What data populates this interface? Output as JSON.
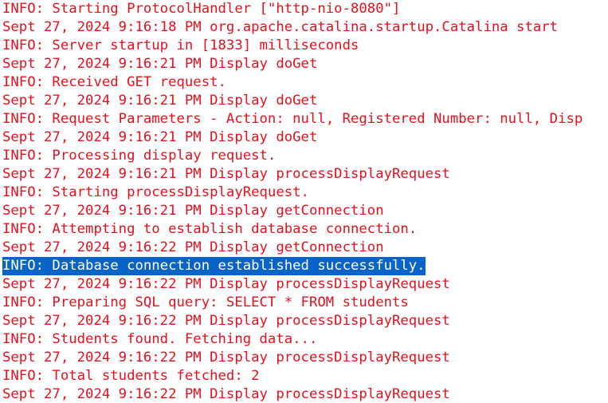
{
  "console": {
    "lines": [
      {
        "text": "INFO: Starting ProtocolHandler [\"http-nio-8080\"]",
        "selected": false
      },
      {
        "text": "Sept 27, 2024 9:16:18 PM org.apache.catalina.startup.Catalina start",
        "selected": false
      },
      {
        "text": "INFO: Server startup in [1833] milliseconds",
        "selected": false
      },
      {
        "text": "Sept 27, 2024 9:16:21 PM Display doGet",
        "selected": false
      },
      {
        "text": "INFO: Received GET request.",
        "selected": false
      },
      {
        "text": "Sept 27, 2024 9:16:21 PM Display doGet",
        "selected": false
      },
      {
        "text": "INFO: Request Parameters - Action: null, Registered Number: null, Disp",
        "selected": false
      },
      {
        "text": "Sept 27, 2024 9:16:21 PM Display doGet",
        "selected": false
      },
      {
        "text": "INFO: Processing display request.",
        "selected": false
      },
      {
        "text": "Sept 27, 2024 9:16:21 PM Display processDisplayRequest",
        "selected": false
      },
      {
        "text": "INFO: Starting processDisplayRequest.",
        "selected": false
      },
      {
        "text": "Sept 27, 2024 9:16:21 PM Display getConnection",
        "selected": false
      },
      {
        "text": "INFO: Attempting to establish database connection.",
        "selected": false
      },
      {
        "text": "Sept 27, 2024 9:16:22 PM Display getConnection",
        "selected": false
      },
      {
        "text": "INFO: Database connection established successfully.",
        "selected": true
      },
      {
        "text": "Sept 27, 2024 9:16:22 PM Display processDisplayRequest",
        "selected": false
      },
      {
        "text": "INFO: Preparing SQL query: SELECT * FROM students",
        "selected": false
      },
      {
        "text": "Sept 27, 2024 9:16:22 PM Display processDisplayRequest",
        "selected": false
      },
      {
        "text": "INFO: Students found. Fetching data...",
        "selected": false
      },
      {
        "text": "Sept 27, 2024 9:16:22 PM Display processDisplayRequest",
        "selected": false
      },
      {
        "text": "INFO: Total students fetched: 2",
        "selected": false
      },
      {
        "text": "Sept 27, 2024 9:16:22 PM Display processDisplayRequest",
        "selected": false
      }
    ],
    "colors": {
      "log_text": "#e8101c",
      "selection_bg": "#0a64c8",
      "selection_text": "#ffffff",
      "background": "#ffffff"
    }
  }
}
